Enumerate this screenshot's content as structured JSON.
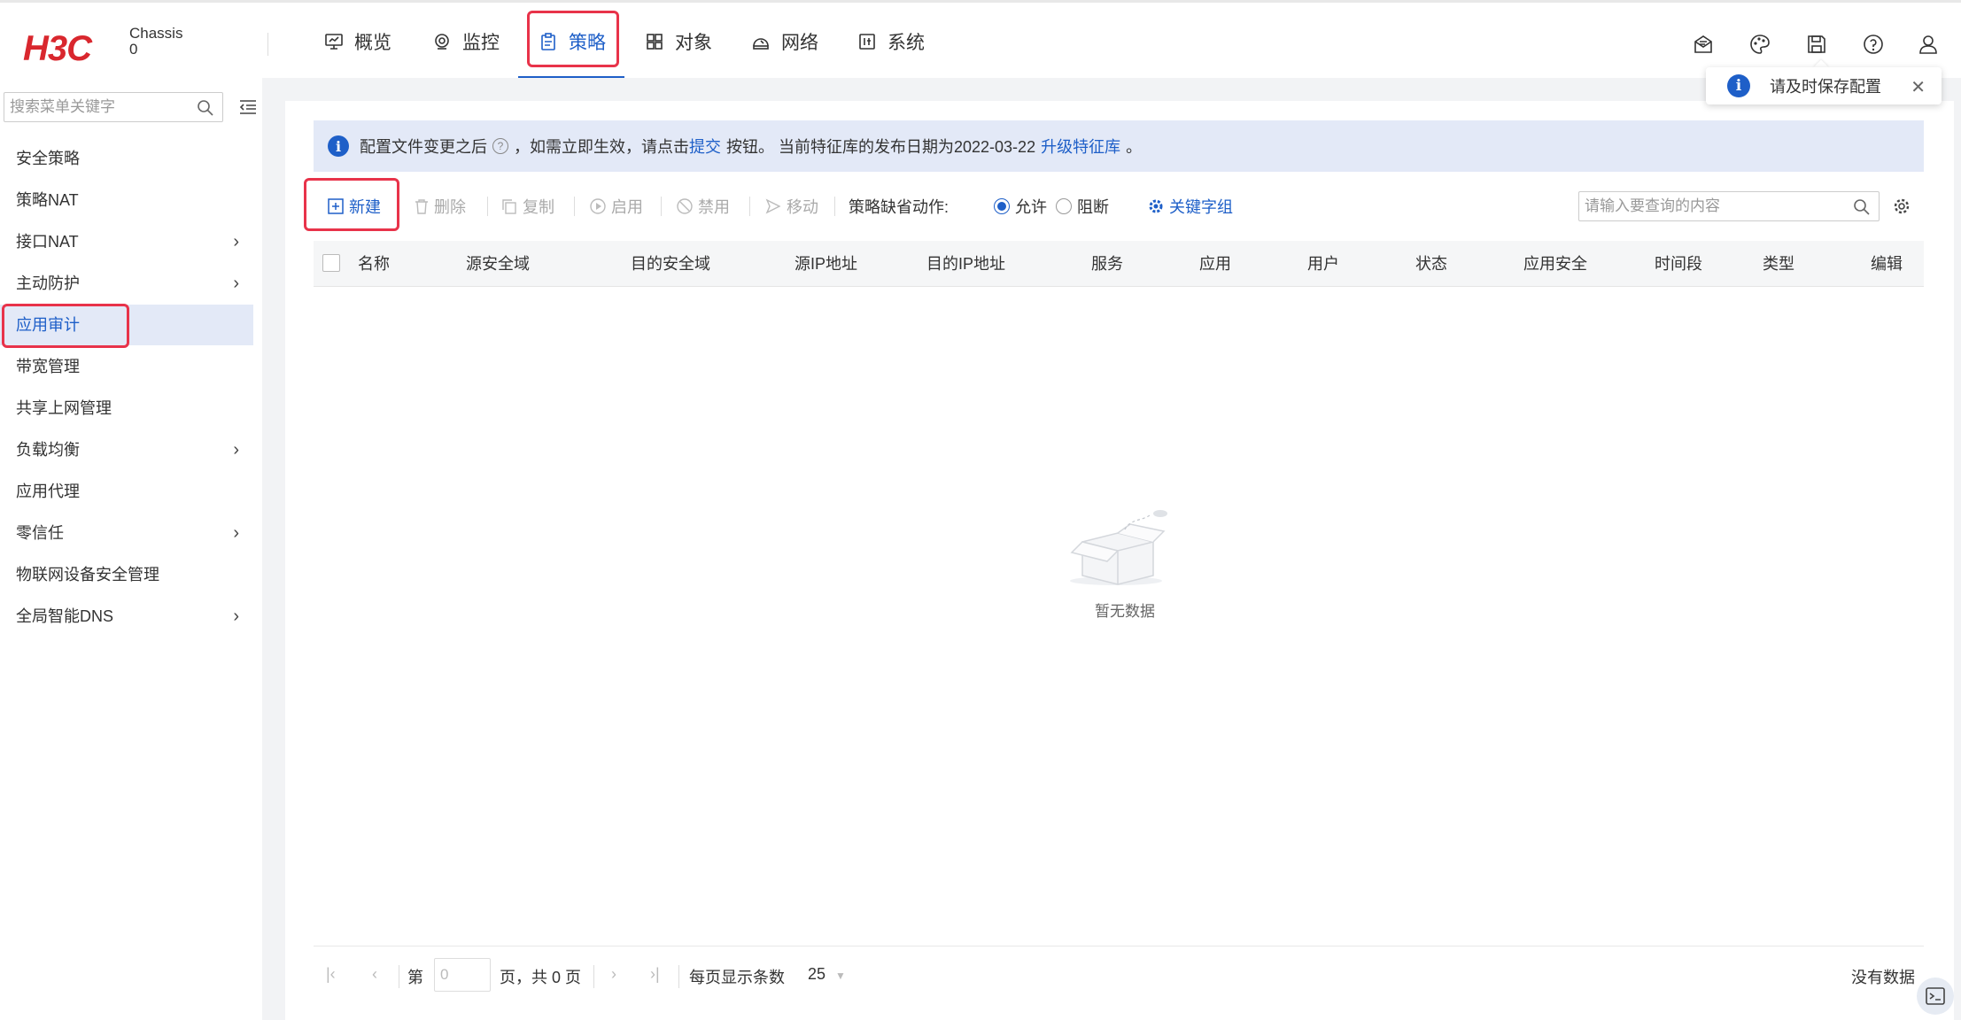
{
  "brand": {
    "logo": "H3C",
    "chassis": "Chassis",
    "chassis_no": "0"
  },
  "nav": [
    {
      "label": "概览",
      "icon": "monitor-icon"
    },
    {
      "label": "监控",
      "icon": "eye-icon"
    },
    {
      "label": "策略",
      "icon": "clipboard-icon",
      "active": true
    },
    {
      "label": "对象",
      "icon": "grid-icon"
    },
    {
      "label": "网络",
      "icon": "network-icon"
    },
    {
      "label": "系统",
      "icon": "system-icon"
    }
  ],
  "header_tools": [
    "mail-icon",
    "palette-icon",
    "save-icon",
    "help-icon",
    "user-icon"
  ],
  "save_tip": "请及时保存配置",
  "sidebar": {
    "search_placeholder": "搜索菜单关键字",
    "items": [
      {
        "label": "安全策略"
      },
      {
        "label": "策略NAT"
      },
      {
        "label": "接口NAT",
        "expandable": true
      },
      {
        "label": "主动防护",
        "expandable": true
      },
      {
        "label": "应用审计",
        "active": true
      },
      {
        "label": "带宽管理"
      },
      {
        "label": "共享上网管理"
      },
      {
        "label": "负载均衡",
        "expandable": true
      },
      {
        "label": "应用代理"
      },
      {
        "label": "零信任",
        "expandable": true
      },
      {
        "label": "物联网设备安全管理"
      },
      {
        "label": "全局智能DNS",
        "expandable": true
      }
    ]
  },
  "notice": {
    "text1": "配置文件变更之后",
    "text2": "，如需立即生效，请点击",
    "submit_link": "提交",
    "text3": "按钮。 当前特征库的发布日期为2022-03-22",
    "upgrade_link": "升级特征库",
    "text4": "。"
  },
  "toolbar": {
    "new": "新建",
    "delete": "删除",
    "copy": "复制",
    "enable": "启用",
    "disable": "禁用",
    "move": "移动",
    "default_action_label": "策略缺省动作:",
    "allow": "允许",
    "deny": "阻断",
    "keyword_group": "关键字组",
    "search_placeholder": "请输入要查询的内容"
  },
  "table": {
    "columns": [
      "名称",
      "源安全域",
      "目的安全域",
      "源IP地址",
      "目的IP地址",
      "服务",
      "应用",
      "用户",
      "状态",
      "应用安全",
      "时间段",
      "类型",
      "编辑"
    ],
    "empty_text": "暂无数据"
  },
  "pagination": {
    "page_label": "第",
    "page_value": "0",
    "total_label": "页，共 0 页",
    "per_page_label": "每页显示条数",
    "per_page_value": "25",
    "status": "没有数据"
  },
  "colors": {
    "accent": "#1e5fc8",
    "brand": "#d9272e",
    "annotation": "#e8334a"
  }
}
